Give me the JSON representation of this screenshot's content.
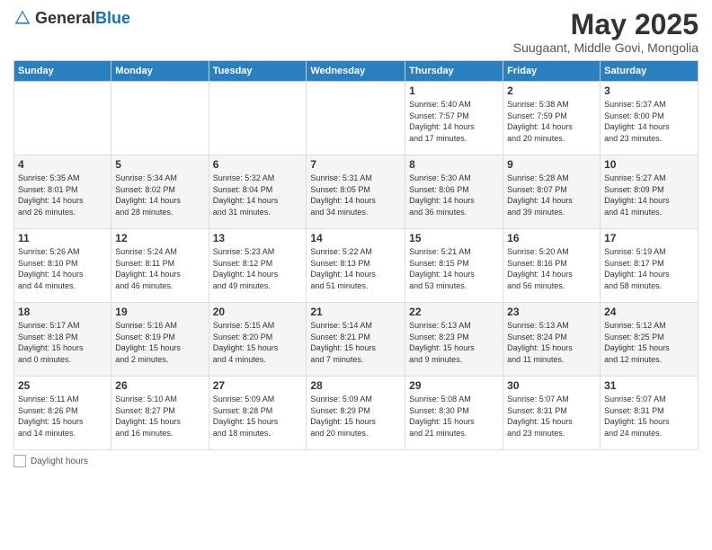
{
  "header": {
    "logo_general": "General",
    "logo_blue": "Blue",
    "main_title": "May 2025",
    "subtitle": "Suugaant, Middle Govi, Mongolia"
  },
  "days_of_week": [
    "Sunday",
    "Monday",
    "Tuesday",
    "Wednesday",
    "Thursday",
    "Friday",
    "Saturday"
  ],
  "weeks": [
    [
      {
        "day": "",
        "detail": ""
      },
      {
        "day": "",
        "detail": ""
      },
      {
        "day": "",
        "detail": ""
      },
      {
        "day": "",
        "detail": ""
      },
      {
        "day": "1",
        "detail": "Sunrise: 5:40 AM\nSunset: 7:57 PM\nDaylight: 14 hours\nand 17 minutes."
      },
      {
        "day": "2",
        "detail": "Sunrise: 5:38 AM\nSunset: 7:59 PM\nDaylight: 14 hours\nand 20 minutes."
      },
      {
        "day": "3",
        "detail": "Sunrise: 5:37 AM\nSunset: 8:00 PM\nDaylight: 14 hours\nand 23 minutes."
      }
    ],
    [
      {
        "day": "4",
        "detail": "Sunrise: 5:35 AM\nSunset: 8:01 PM\nDaylight: 14 hours\nand 26 minutes."
      },
      {
        "day": "5",
        "detail": "Sunrise: 5:34 AM\nSunset: 8:02 PM\nDaylight: 14 hours\nand 28 minutes."
      },
      {
        "day": "6",
        "detail": "Sunrise: 5:32 AM\nSunset: 8:04 PM\nDaylight: 14 hours\nand 31 minutes."
      },
      {
        "day": "7",
        "detail": "Sunrise: 5:31 AM\nSunset: 8:05 PM\nDaylight: 14 hours\nand 34 minutes."
      },
      {
        "day": "8",
        "detail": "Sunrise: 5:30 AM\nSunset: 8:06 PM\nDaylight: 14 hours\nand 36 minutes."
      },
      {
        "day": "9",
        "detail": "Sunrise: 5:28 AM\nSunset: 8:07 PM\nDaylight: 14 hours\nand 39 minutes."
      },
      {
        "day": "10",
        "detail": "Sunrise: 5:27 AM\nSunset: 8:09 PM\nDaylight: 14 hours\nand 41 minutes."
      }
    ],
    [
      {
        "day": "11",
        "detail": "Sunrise: 5:26 AM\nSunset: 8:10 PM\nDaylight: 14 hours\nand 44 minutes."
      },
      {
        "day": "12",
        "detail": "Sunrise: 5:24 AM\nSunset: 8:11 PM\nDaylight: 14 hours\nand 46 minutes."
      },
      {
        "day": "13",
        "detail": "Sunrise: 5:23 AM\nSunset: 8:12 PM\nDaylight: 14 hours\nand 49 minutes."
      },
      {
        "day": "14",
        "detail": "Sunrise: 5:22 AM\nSunset: 8:13 PM\nDaylight: 14 hours\nand 51 minutes."
      },
      {
        "day": "15",
        "detail": "Sunrise: 5:21 AM\nSunset: 8:15 PM\nDaylight: 14 hours\nand 53 minutes."
      },
      {
        "day": "16",
        "detail": "Sunrise: 5:20 AM\nSunset: 8:16 PM\nDaylight: 14 hours\nand 56 minutes."
      },
      {
        "day": "17",
        "detail": "Sunrise: 5:19 AM\nSunset: 8:17 PM\nDaylight: 14 hours\nand 58 minutes."
      }
    ],
    [
      {
        "day": "18",
        "detail": "Sunrise: 5:17 AM\nSunset: 8:18 PM\nDaylight: 15 hours\nand 0 minutes."
      },
      {
        "day": "19",
        "detail": "Sunrise: 5:16 AM\nSunset: 8:19 PM\nDaylight: 15 hours\nand 2 minutes."
      },
      {
        "day": "20",
        "detail": "Sunrise: 5:15 AM\nSunset: 8:20 PM\nDaylight: 15 hours\nand 4 minutes."
      },
      {
        "day": "21",
        "detail": "Sunrise: 5:14 AM\nSunset: 8:21 PM\nDaylight: 15 hours\nand 7 minutes."
      },
      {
        "day": "22",
        "detail": "Sunrise: 5:13 AM\nSunset: 8:23 PM\nDaylight: 15 hours\nand 9 minutes."
      },
      {
        "day": "23",
        "detail": "Sunrise: 5:13 AM\nSunset: 8:24 PM\nDaylight: 15 hours\nand 11 minutes."
      },
      {
        "day": "24",
        "detail": "Sunrise: 5:12 AM\nSunset: 8:25 PM\nDaylight: 15 hours\nand 12 minutes."
      }
    ],
    [
      {
        "day": "25",
        "detail": "Sunrise: 5:11 AM\nSunset: 8:26 PM\nDaylight: 15 hours\nand 14 minutes."
      },
      {
        "day": "26",
        "detail": "Sunrise: 5:10 AM\nSunset: 8:27 PM\nDaylight: 15 hours\nand 16 minutes."
      },
      {
        "day": "27",
        "detail": "Sunrise: 5:09 AM\nSunset: 8:28 PM\nDaylight: 15 hours\nand 18 minutes."
      },
      {
        "day": "28",
        "detail": "Sunrise: 5:09 AM\nSunset: 8:29 PM\nDaylight: 15 hours\nand 20 minutes."
      },
      {
        "day": "29",
        "detail": "Sunrise: 5:08 AM\nSunset: 8:30 PM\nDaylight: 15 hours\nand 21 minutes."
      },
      {
        "day": "30",
        "detail": "Sunrise: 5:07 AM\nSunset: 8:31 PM\nDaylight: 15 hours\nand 23 minutes."
      },
      {
        "day": "31",
        "detail": "Sunrise: 5:07 AM\nSunset: 8:31 PM\nDaylight: 15 hours\nand 24 minutes."
      }
    ]
  ],
  "footer": {
    "daylight_label": "Daylight hours"
  }
}
